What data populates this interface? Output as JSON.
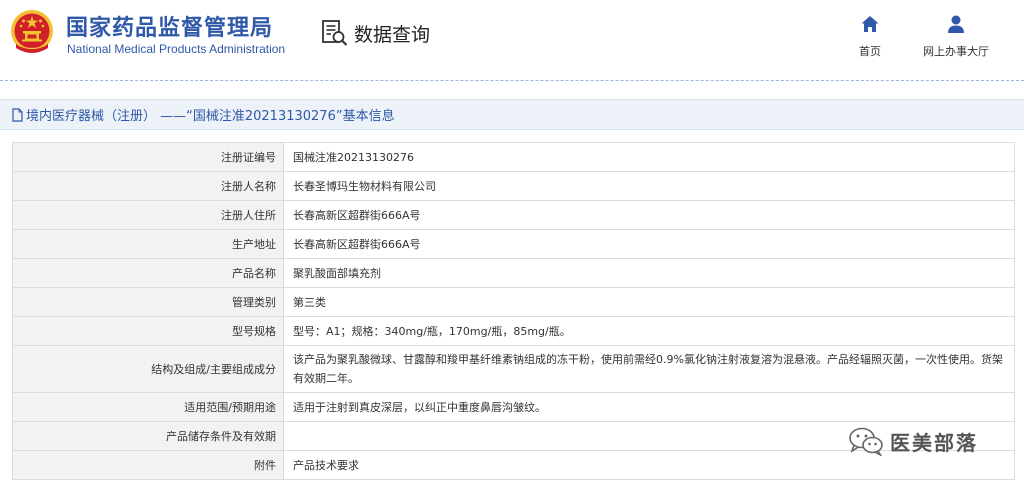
{
  "header": {
    "org_name_cn": "国家药品监督管理局",
    "org_name_en": "National Medical Products Administration",
    "query_label": "数据查询",
    "nav": [
      {
        "label": "首页",
        "icon": "home-icon"
      },
      {
        "label": "网上办事大厅",
        "icon": "user-icon"
      }
    ]
  },
  "title_bar": {
    "text": "境内医疗器械（注册） ——“国械注准20213130276”基本信息",
    "icon": "document-icon"
  },
  "record": {
    "rows": [
      {
        "label": "注册证编号",
        "value": "国械注准20213130276"
      },
      {
        "label": "注册人名称",
        "value": "长春圣博玛生物材料有限公司"
      },
      {
        "label": "注册人住所",
        "value": "长春高新区超群街666A号"
      },
      {
        "label": "生产地址",
        "value": "长春高新区超群街666A号"
      },
      {
        "label": "产品名称",
        "value": "聚乳酸面部填充剂"
      },
      {
        "label": "管理类别",
        "value": "第三类"
      },
      {
        "label": "型号规格",
        "value": "型号：A1；规格：340mg/瓶，170mg/瓶，85mg/瓶。"
      },
      {
        "label": "结构及组成/主要组成成分",
        "value": "该产品为聚乳酸微球、甘露醇和羧甲基纤维素钠组成的冻干粉，使用前需经0.9%氯化钠注射液复溶为混悬液。产品经辐照灭菌，一次性使用。货架有效期二年。"
      },
      {
        "label": "适用范围/预期用途",
        "value": "适用于注射到真皮深层，以纠正中重度鼻唇沟皱纹。"
      },
      {
        "label": "产品储存条件及有效期",
        "value": ""
      },
      {
        "label": "附件",
        "value": "产品技术要求"
      }
    ]
  },
  "watermark": {
    "text": "医美部落",
    "icon": "wechat-icon"
  },
  "colors": {
    "brand_blue": "#2f58a8",
    "emblem_red": "#d0202a",
    "emblem_gold": "#f2c230",
    "label_bg": "#f2f2f2",
    "titlebar_bg": "#edf2f9"
  }
}
